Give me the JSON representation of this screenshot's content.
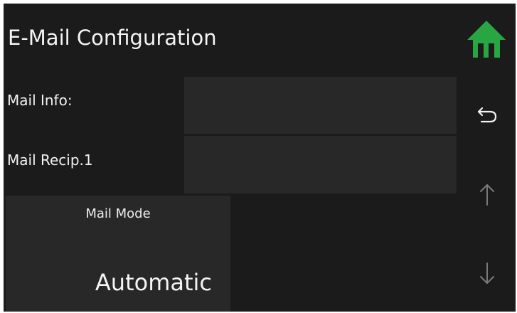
{
  "header": {
    "title": "E-Mail Configuration",
    "home_icon": "home-icon",
    "home_icon_color": "#27a641"
  },
  "form": {
    "mail_info": {
      "label": "Mail Info:",
      "value": ""
    },
    "mail_recipient_1": {
      "label": "Mail Recip.1",
      "value": ""
    }
  },
  "mail_mode": {
    "label": "Mail Mode",
    "value": "Automatic"
  },
  "side_nav": {
    "back_icon": "return-arrow-icon",
    "up_icon": "arrow-up-icon",
    "down_icon": "arrow-down-icon"
  },
  "colors": {
    "background": "#1b1b1b",
    "panel": "#282828",
    "text": "#f2f2f2",
    "disabled_arrow": "#7a7a7a"
  }
}
